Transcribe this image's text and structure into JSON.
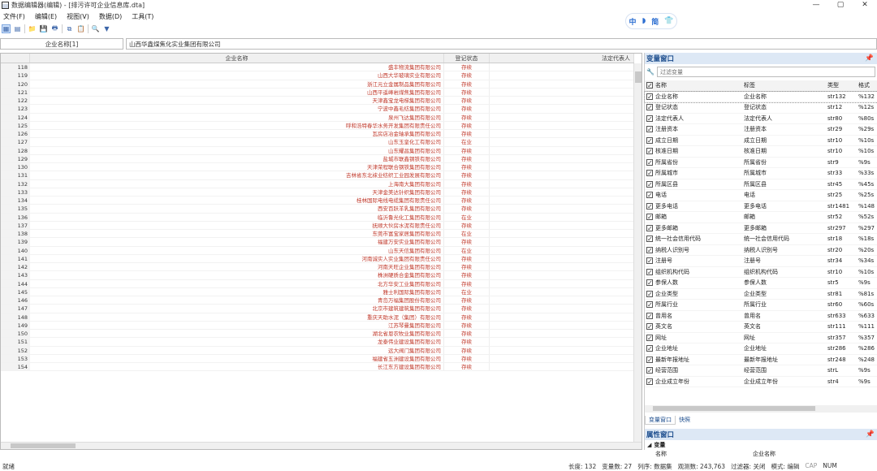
{
  "window": {
    "title": "数据编辑器(编辑) - [排污许可企业信息库.dta]",
    "min": "—",
    "max": "▢",
    "close": "✕"
  },
  "menu": [
    "文件(F)",
    "编辑(E)",
    "视图(V)",
    "数据(D)",
    "工具(T)"
  ],
  "ime": {
    "a": "中",
    "b": "◗",
    "c": "简",
    "d": "👕"
  },
  "varbar": {
    "name": "企业名称[1]",
    "value": "山西华鑫煤焦化实业集团有限公司"
  },
  "grid": {
    "columns": [
      "",
      "企业名称",
      "登记状态",
      "法定代表人"
    ],
    "rows": [
      [
        "118",
        "盛丰物流集团有限公司",
        "存续"
      ],
      [
        "119",
        "山西大华玻璃实业有限公司",
        "存续"
      ],
      [
        "120",
        "浙江元立金属制品集团有限公司",
        "存续"
      ],
      [
        "121",
        "山西平遥峰岩煤焦集团有限公司",
        "存续"
      ],
      [
        "122",
        "天津鑫宝龙电梯集团有限公司",
        "存续"
      ],
      [
        "123",
        "宁波中鑫毛纺集团有限公司",
        "存续"
      ],
      [
        "124",
        "泉州飞达集团有限公司",
        "存续"
      ],
      [
        "125",
        "呼和浩特春华水务开发集团有限责任公司",
        "存续"
      ],
      [
        "126",
        "瓦房店冶金轴承集团有限公司",
        "存续"
      ],
      [
        "127",
        "山东玉皇化工有限公司",
        "在业"
      ],
      [
        "128",
        "山东耀昌集团有限公司",
        "存续"
      ],
      [
        "129",
        "盐城市联鑫钢铁有限公司",
        "存续"
      ],
      [
        "130",
        "天津荣程联合钢铁集团有限公司",
        "存续"
      ],
      [
        "131",
        "吉林省东北袜业纺织工业园发展有限公司",
        "存续"
      ],
      [
        "132",
        "上海南大集团有限公司",
        "存续"
      ],
      [
        "133",
        "天津金美达针织集团有限公司",
        "存续"
      ],
      [
        "134",
        "桂林国际电线电缆集团有限责任公司",
        "存续"
      ],
      [
        "135",
        "西安百跃羊乳集团有限公司",
        "存续"
      ],
      [
        "136",
        "临沂鲁光化工集团有限公司",
        "在业"
      ],
      [
        "137",
        "抚顺大伙房水泥有限责任公司",
        "存续"
      ],
      [
        "138",
        "东莞市富宝家居集团有限公司",
        "在业"
      ],
      [
        "139",
        "福建万安实业集团有限公司",
        "存续"
      ],
      [
        "140",
        "山东天信集团有限公司",
        "在业"
      ],
      [
        "141",
        "河南诚实人实业集团有限责任公司",
        "存续"
      ],
      [
        "142",
        "河南天旺企业集团有限公司",
        "存续"
      ],
      [
        "143",
        "株洲硬质合金集团有限公司",
        "存续"
      ],
      [
        "144",
        "北方华安工业集团有限公司",
        "存续"
      ],
      [
        "145",
        "雅士利国际集团有限公司",
        "在业"
      ],
      [
        "146",
        "青岛万福集团股份有限公司",
        "存续"
      ],
      [
        "147",
        "北京市建筑建筑集团有限公司",
        "存续"
      ],
      [
        "148",
        "重庆天助水泥（集团）有限公司",
        "存续"
      ],
      [
        "149",
        "江苏琴曼集团有限公司",
        "存续"
      ],
      [
        "150",
        "湖北省恩农牧业集团有限公司",
        "存续"
      ],
      [
        "151",
        "龙泰伟业建设集团有限公司",
        "存续"
      ],
      [
        "152",
        "远大阀门集团有限公司",
        "存续"
      ],
      [
        "153",
        "福建省五洲建设集团有限公司",
        "存续"
      ],
      [
        "154",
        "长江东方建设集团有限公司",
        "存续"
      ]
    ]
  },
  "varpanel": {
    "title": "变量窗口",
    "pin": "𝗽",
    "filter_placeholder": "过滤变量",
    "headers": [
      "名称",
      "标签",
      "类型",
      "格式"
    ],
    "vars": [
      [
        "企业名称",
        "企业名称",
        "str132",
        "%132"
      ],
      [
        "登记状态",
        "登记状态",
        "str12",
        "%12s"
      ],
      [
        "法定代表人",
        "法定代表人",
        "str80",
        "%80s"
      ],
      [
        "注册资本",
        "注册资本",
        "str29",
        "%29s"
      ],
      [
        "成立日期",
        "成立日期",
        "str10",
        "%10s"
      ],
      [
        "核准日期",
        "核准日期",
        "str10",
        "%10s"
      ],
      [
        "所属省份",
        "所属省份",
        "str9",
        "%9s"
      ],
      [
        "所属城市",
        "所属城市",
        "str33",
        "%33s"
      ],
      [
        "所属区县",
        "所属区县",
        "str45",
        "%45s"
      ],
      [
        "电话",
        "电话",
        "str25",
        "%25s"
      ],
      [
        "更多电话",
        "更多电话",
        "str1481",
        "%148"
      ],
      [
        "邮箱",
        "邮箱",
        "str52",
        "%52s"
      ],
      [
        "更多邮箱",
        "更多邮箱",
        "str297",
        "%297"
      ],
      [
        "统一社会信用代码",
        "统一社会信用代码",
        "str18",
        "%18s"
      ],
      [
        "纳税人识别号",
        "纳税人识别号",
        "str20",
        "%20s"
      ],
      [
        "注册号",
        "注册号",
        "str34",
        "%34s"
      ],
      [
        "组织机构代码",
        "组织机构代码",
        "str10",
        "%10s"
      ],
      [
        "参保人数",
        "参保人数",
        "str5",
        "%9s"
      ],
      [
        "企业类型",
        "企业类型",
        "str81",
        "%81s"
      ],
      [
        "所属行业",
        "所属行业",
        "str60",
        "%60s"
      ],
      [
        "曾用名",
        "曾用名",
        "str633",
        "%633"
      ],
      [
        "英文名",
        "英文名",
        "str111",
        "%111"
      ],
      [
        "网址",
        "网址",
        "str357",
        "%357"
      ],
      [
        "企业地址",
        "企业地址",
        "str286",
        "%286"
      ],
      [
        "最新年报地址",
        "最新年报地址",
        "str248",
        "%248"
      ],
      [
        "经营范围",
        "经营范围",
        "strL",
        "%9s"
      ],
      [
        "企业成立年份",
        "企业成立年份",
        "str4",
        "%9s"
      ]
    ],
    "tabs": [
      "变量窗口",
      "快照"
    ]
  },
  "props": {
    "title": "属性窗口",
    "section": "变量",
    "row_label": "名称",
    "row_value": "企业名称"
  },
  "status": {
    "ready": "就绪",
    "length": "长度: 132",
    "vars": "变量数: 27",
    "order": "列序: 数据集",
    "obs": "观测数: 243,763",
    "filter": "过滤器: 关闭",
    "mode": "模式: 编辑",
    "cap": "CAP",
    "num": "NUM"
  }
}
